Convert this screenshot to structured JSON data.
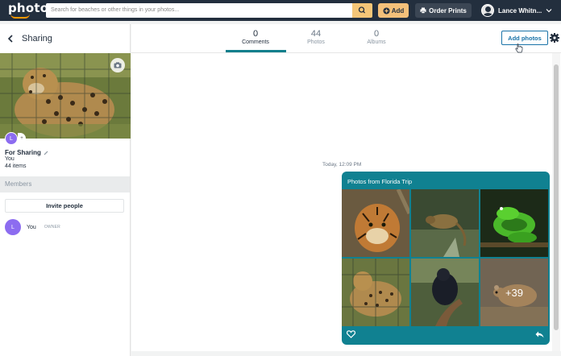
{
  "topbar": {
    "logo_text": "photos",
    "search_placeholder": "Search for beaches or other things in your photos...",
    "add_label": "Add",
    "order_prints_label": "Order Prints",
    "user_name": "Lance Whitn..."
  },
  "sidebar": {
    "back_title": "Sharing",
    "avatar_initial": "L",
    "avatar_extra": "+",
    "album_name": "For Sharing",
    "album_owner": "You",
    "item_count": "44 items",
    "members_heading": "Members",
    "invite_label": "Invite people",
    "members": [
      {
        "initial": "L",
        "name": "You",
        "role": "OWNER"
      }
    ]
  },
  "tabs": [
    {
      "count": "0",
      "label": "Comments",
      "active": true
    },
    {
      "count": "44",
      "label": "Photos",
      "active": false
    },
    {
      "count": "0",
      "label": "Albums",
      "active": false
    }
  ],
  "main": {
    "add_photos_label": "Add photos",
    "timestamp": "Today, 12:09 PM",
    "card": {
      "title": "Photos from Florida Trip",
      "more_count": "+39",
      "photos": [
        "tiger",
        "small-mammal",
        "green-snake",
        "leopard",
        "black-bird",
        "mouse"
      ]
    }
  },
  "colors": {
    "topbar": "#232f3e",
    "accent": "#108191",
    "brand_orange": "#ff9900",
    "link_blue": "#1a73a8",
    "avatar_purple": "#8c6cf0"
  }
}
